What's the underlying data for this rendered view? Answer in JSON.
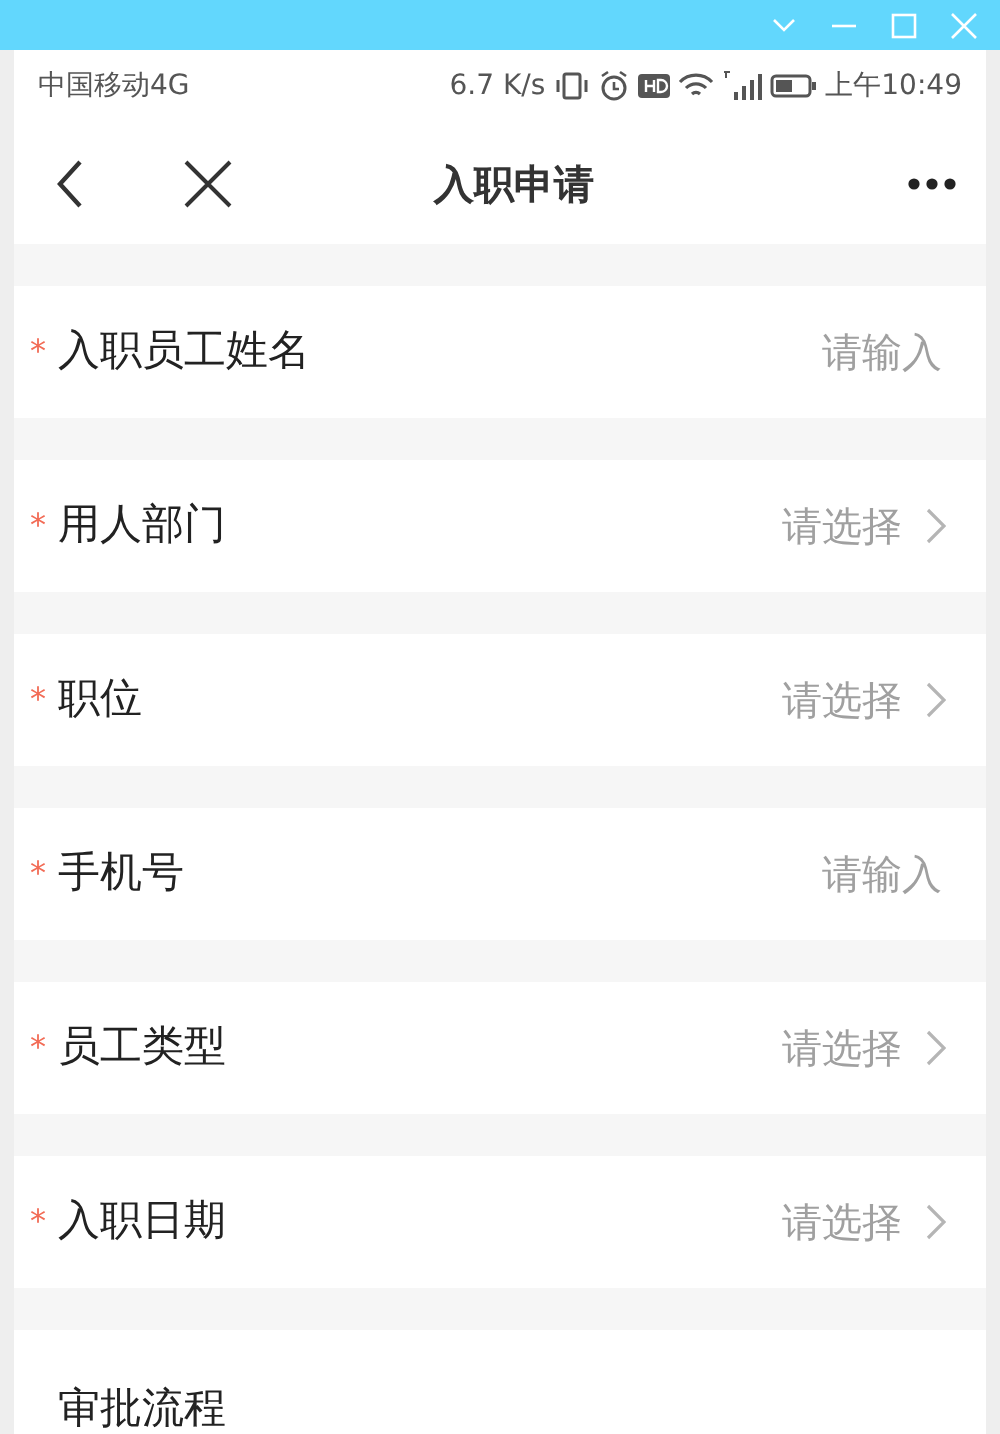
{
  "status_bar": {
    "carrier": "中国移动4G",
    "speed": "6.7 K/s",
    "time": "上午10:49"
  },
  "nav": {
    "title": "入职申请"
  },
  "fields": [
    {
      "required_mark": "*",
      "label": "入职员工姓名",
      "kind": "input",
      "placeholder": "请输入"
    },
    {
      "required_mark": "*",
      "label": "用人部门",
      "kind": "select",
      "placeholder": "请选择"
    },
    {
      "required_mark": "*",
      "label": "职位",
      "kind": "select",
      "placeholder": "请选择"
    },
    {
      "required_mark": "*",
      "label": "手机号",
      "kind": "input",
      "placeholder": "请输入"
    },
    {
      "required_mark": "*",
      "label": "员工类型",
      "kind": "select",
      "placeholder": "请选择"
    },
    {
      "required_mark": "*",
      "label": "入职日期",
      "kind": "select",
      "placeholder": "请选择"
    }
  ],
  "section": {
    "title": "审批流程"
  }
}
